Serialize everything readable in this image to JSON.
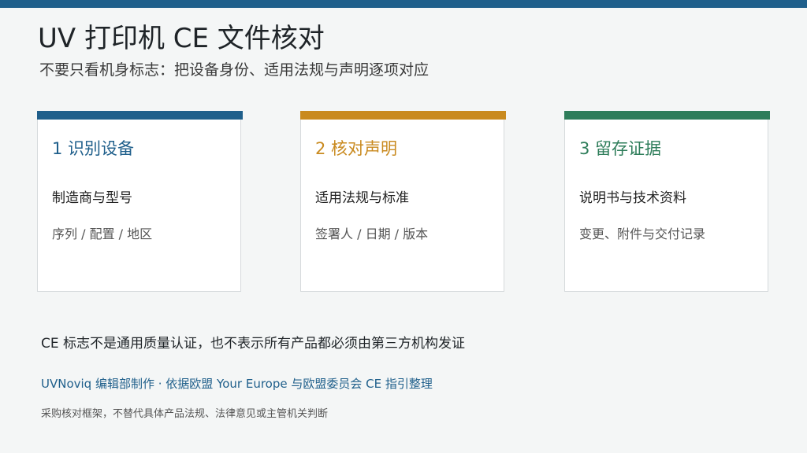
{
  "colors": {
    "top_bar": "#1f5f8b",
    "step1": "#1f5f8b",
    "step2": "#c98a1f",
    "step3": "#2e7d5a",
    "background": "#f4f6f6"
  },
  "header": {
    "title": "UV 打印机 CE 文件核对",
    "subtitle": "不要只看机身标志：把设备身份、适用法规与声明逐项对应"
  },
  "steps": [
    {
      "title": "1  识别设备",
      "main": "制造商与型号",
      "sub": "序列 / 配置 / 地区"
    },
    {
      "title": "2  核对声明",
      "main": "适用法规与标准",
      "sub": "签署人 / 日期 / 版本"
    },
    {
      "title": "3  留存证据",
      "main": "说明书与技术资料",
      "sub": "变更、附件与交付记录"
    }
  ],
  "footer": {
    "note": "CE 标志不是通用质量认证，也不表示所有产品都必须由第三方机构发证",
    "source": "UVNoviq 编辑部制作 · 依据欧盟 Your Europe 与欧盟委员会 CE 指引整理",
    "disclaimer": "采购核对框架，不替代具体产品法规、法律意见或主管机关判断"
  }
}
